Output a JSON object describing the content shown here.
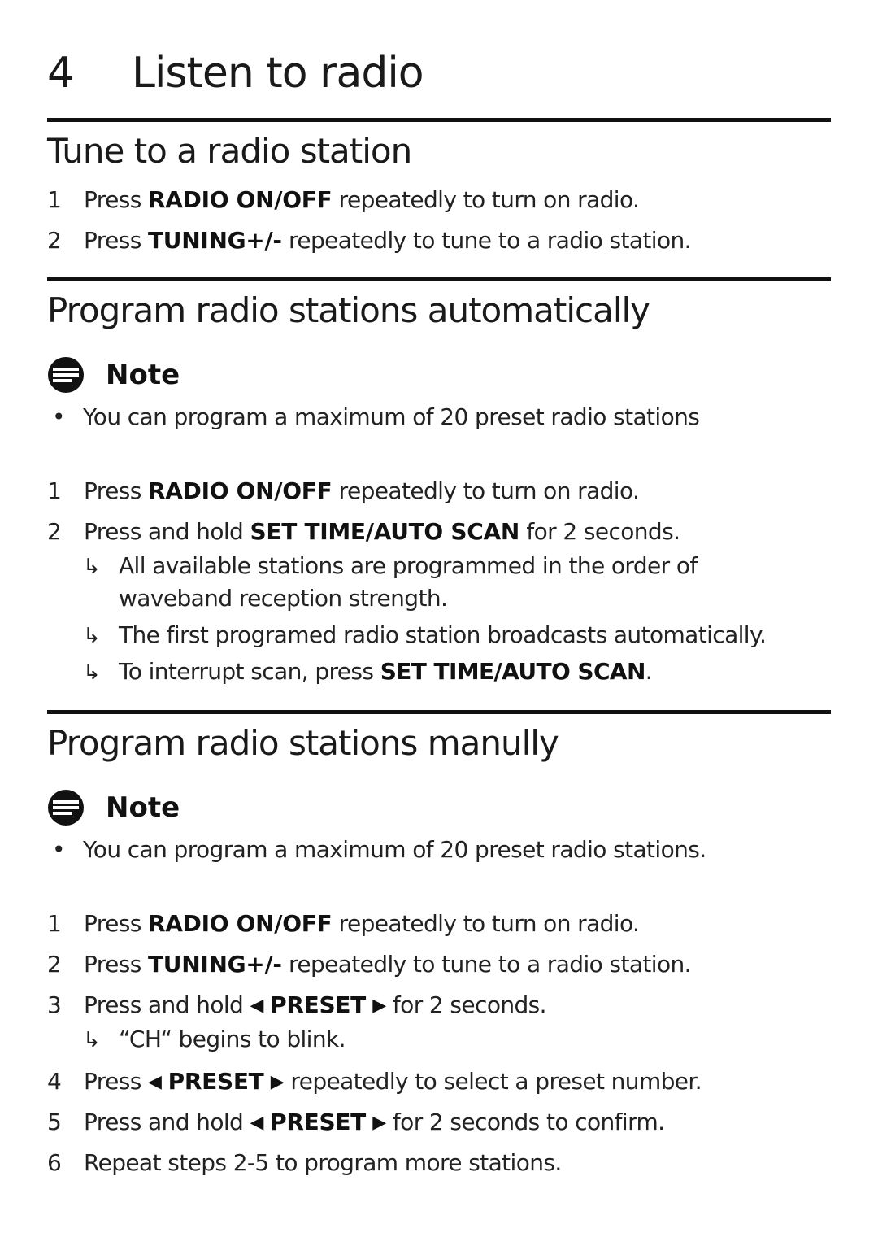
{
  "chapter": {
    "number": "4",
    "title": "Listen to radio"
  },
  "sections": [
    {
      "title": "Tune to a radio station",
      "steps": [
        {
          "num": "1",
          "pre": "Press ",
          "key": "RADIO ON/OFF",
          "post": " repeatedly to turn on radio."
        },
        {
          "num": "2",
          "pre": "Press ",
          "key": "TUNING+/-",
          "post": " repeatedly to tune to a radio station."
        }
      ]
    },
    {
      "title": "Program radio stations automatically",
      "note": {
        "label": "Note",
        "icon": "note-icon",
        "bullet": "You can program a maximum of 20 preset radio stations"
      },
      "steps": [
        {
          "num": "1",
          "pre": "Press ",
          "key": "RADIO ON/OFF",
          "post": " repeatedly to turn on radio."
        },
        {
          "num": "2",
          "pre": "Press and hold ",
          "key": "SET TIME/AUTO SCAN",
          "post": " for 2 seconds."
        }
      ],
      "results": [
        {
          "line1": "All available stations are programmed in the order of",
          "line2": "waveband reception strength."
        },
        {
          "line1": "The first programed radio station broadcasts automatically."
        },
        {
          "pre": "To interrupt scan, press ",
          "key": "SET TIME/AUTO SCAN",
          "post": "."
        }
      ]
    },
    {
      "title": "Program radio stations manully",
      "note": {
        "label": "Note",
        "icon": "note-icon",
        "bullet": "You can program a maximum of 20 preset radio stations."
      },
      "steps": [
        {
          "num": "1",
          "pre": "Press ",
          "key": "RADIO ON/OFF",
          "post": " repeatedly to turn on radio."
        },
        {
          "num": "2",
          "pre": "Press ",
          "key": "TUNING+/-",
          "post": " repeatedly to tune to a radio station."
        },
        {
          "num": "3",
          "pre": "Press and hold ",
          "key": "PRESET",
          "post": " for 2 seconds.",
          "result": "“CH“ begins to blink."
        },
        {
          "num": "4",
          "pre": "Press ",
          "key": "PRESET",
          "post": " repeatedly to select a preset number."
        },
        {
          "num": "5",
          "pre": "Press and hold ",
          "key": "PRESET",
          "post": " for 2 seconds to confirm."
        },
        {
          "num": "6",
          "text": "Repeat steps 2-5 to program more stations."
        }
      ]
    }
  ],
  "icons": {
    "result_arrow": "↳",
    "left_triangle": "◀",
    "right_triangle": "▶",
    "bullet": "•"
  }
}
